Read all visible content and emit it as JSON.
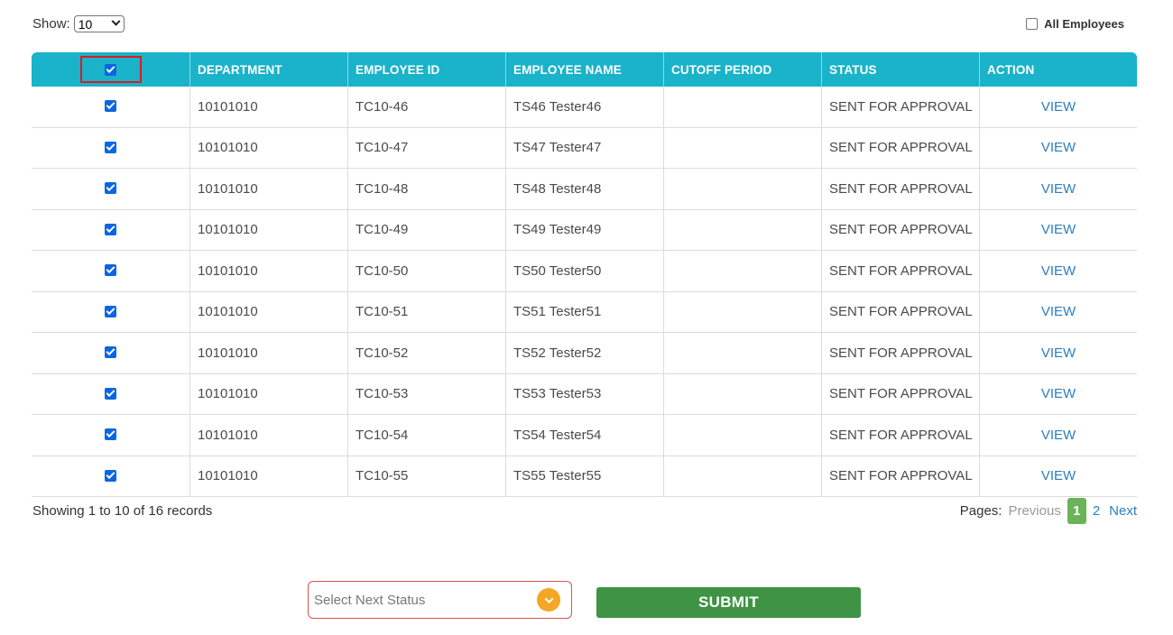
{
  "show": {
    "label": "Show:",
    "value": "10"
  },
  "all_employees": {
    "label": "All Employees",
    "checked": false
  },
  "table": {
    "headers": [
      "",
      "DEPARTMENT",
      "EMPLOYEE ID",
      "EMPLOYEE NAME",
      "CUTOFF PERIOD",
      "STATUS",
      "ACTION"
    ],
    "rows": [
      {
        "department": "10101010",
        "employee_id": "TC10-46",
        "employee_name": "TS46 Tester46",
        "cutoff_period": "",
        "status": "SENT FOR APPROVAL",
        "action": "VIEW"
      },
      {
        "department": "10101010",
        "employee_id": "TC10-47",
        "employee_name": "TS47 Tester47",
        "cutoff_period": "",
        "status": "SENT FOR APPROVAL",
        "action": "VIEW"
      },
      {
        "department": "10101010",
        "employee_id": "TC10-48",
        "employee_name": "TS48 Tester48",
        "cutoff_period": "",
        "status": "SENT FOR APPROVAL",
        "action": "VIEW"
      },
      {
        "department": "10101010",
        "employee_id": "TC10-49",
        "employee_name": "TS49 Tester49",
        "cutoff_period": "",
        "status": "SENT FOR APPROVAL",
        "action": "VIEW"
      },
      {
        "department": "10101010",
        "employee_id": "TC10-50",
        "employee_name": "TS50 Tester50",
        "cutoff_period": "",
        "status": "SENT FOR APPROVAL",
        "action": "VIEW"
      },
      {
        "department": "10101010",
        "employee_id": "TC10-51",
        "employee_name": "TS51 Tester51",
        "cutoff_period": "",
        "status": "SENT FOR APPROVAL",
        "action": "VIEW"
      },
      {
        "department": "10101010",
        "employee_id": "TC10-52",
        "employee_name": "TS52 Tester52",
        "cutoff_period": "",
        "status": "SENT FOR APPROVAL",
        "action": "VIEW"
      },
      {
        "department": "10101010",
        "employee_id": "TC10-53",
        "employee_name": "TS53 Tester53",
        "cutoff_period": "",
        "status": "SENT FOR APPROVAL",
        "action": "VIEW"
      },
      {
        "department": "10101010",
        "employee_id": "TC10-54",
        "employee_name": "TS54 Tester54",
        "cutoff_period": "",
        "status": "SENT FOR APPROVAL",
        "action": "VIEW"
      },
      {
        "department": "10101010",
        "employee_id": "TC10-55",
        "employee_name": "TS55 Tester55",
        "cutoff_period": "",
        "status": "SENT FOR APPROVAL",
        "action": "VIEW"
      }
    ]
  },
  "footer": {
    "records_text": "Showing 1 to 10 of 16 records",
    "pages_label": "Pages:",
    "previous": "Previous",
    "pages": [
      "1",
      "2"
    ],
    "current_page": "1",
    "next": "Next"
  },
  "bottom": {
    "status_placeholder": "Select Next Status",
    "submit_label": "SUBMIT"
  },
  "colors": {
    "header_bg": "#1ab3c9",
    "checkbox": "#0a66e4",
    "link": "#2a7fc1",
    "active_page": "#6bb35a",
    "submit_bg": "#3e9444",
    "dropdown_icon": "#f5a623",
    "highlight_border": "#e0191f"
  }
}
